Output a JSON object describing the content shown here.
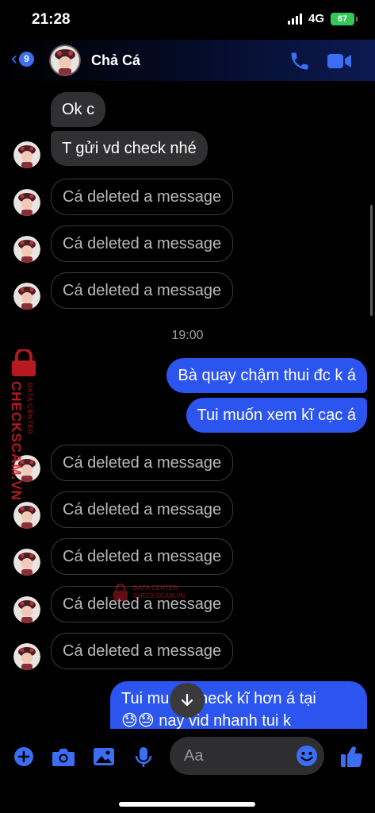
{
  "status_bar": {
    "time": "21:28",
    "network": "4G",
    "battery": "67"
  },
  "header": {
    "back_badge": "9",
    "contact_name": "Chả Cá"
  },
  "messages_top": [
    {
      "text": "Ok c"
    },
    {
      "text": "T gửi vd check nhé"
    },
    {
      "text": "Cá deleted a message"
    },
    {
      "text": "Cá deleted a message"
    },
    {
      "text": "Cá deleted a message"
    }
  ],
  "time_divider": "19:00",
  "outgoing": [
    {
      "text": "Bà quay chậm thui đc k á"
    },
    {
      "text": "Tui muốn xem kĩ cạc á"
    }
  ],
  "messages_bottom": [
    {
      "text": "Cá deleted a message"
    },
    {
      "text": "Cá deleted a message"
    },
    {
      "text": "Cá deleted a message"
    },
    {
      "text": "Cá deleted a message"
    },
    {
      "text": "Cá deleted a message"
    }
  ],
  "last_outgoing": {
    "line1": "Tui muốn check kĩ hơn á tại",
    "line2": "😓😓 nay vid nhanh tui k"
  },
  "watermark": {
    "brand": "CHECKSCAM.VN",
    "tag": "DATA CENTER"
  },
  "composer": {
    "placeholder": "Aa"
  },
  "colors": {
    "accent": "#3b6ef5",
    "outgoing_bubble": "#2c55f0",
    "incoming_bubble": "#303032",
    "watermark": "#d61f26"
  },
  "icons": [
    "plus-icon",
    "camera-icon",
    "image-icon",
    "mic-icon",
    "emoji-icon",
    "like-icon",
    "phone-icon",
    "video-icon",
    "scroll-down-arrow-icon"
  ]
}
